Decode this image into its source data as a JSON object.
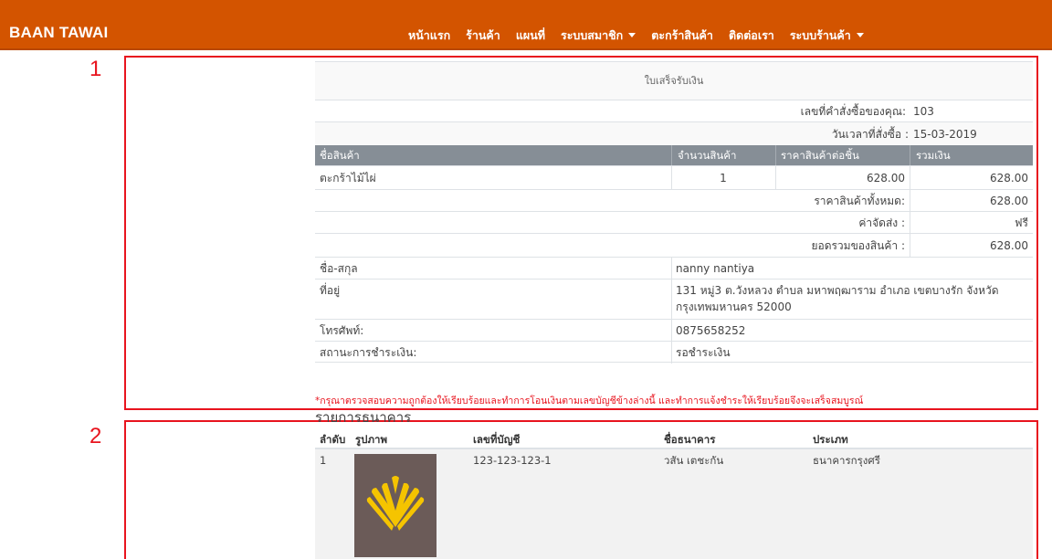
{
  "navbar": {
    "brand": "BAAN TAWAI",
    "items": [
      {
        "label": "หน้าแรก",
        "dropdown": false
      },
      {
        "label": "ร้านค้า",
        "dropdown": false
      },
      {
        "label": "แผนที่",
        "dropdown": false
      },
      {
        "label": "ระบบสมาชิก",
        "dropdown": true
      },
      {
        "label": "ตะกร้าสินค้า",
        "dropdown": false
      },
      {
        "label": "ติดต่อเรา",
        "dropdown": false
      },
      {
        "label": "ระบบร้านค้า",
        "dropdown": true
      }
    ],
    "color": "#d35400"
  },
  "annotations": {
    "box1_label": "1",
    "box2_label": "2",
    "color": "#e8141e"
  },
  "receipt": {
    "title": "ใบเสร็จรับเงิน",
    "order_no_label": "เลขที่คำสั่งซื้อของคุณ:",
    "order_no": "103",
    "order_date_label": "วันเวลาที่สั่งซื้อ :",
    "order_date": "15-03-2019",
    "headers": [
      "ชื่อสินค้า",
      "จำนวนสินค้า",
      "ราคาสินค้าต่อชิ้น",
      "รวมเงิน"
    ],
    "items": [
      {
        "name": "ตะกร้าไม้ไผ่",
        "qty": "1",
        "unit_price": "628.00",
        "total": "628.00"
      }
    ],
    "subtotal_label": "ราคาสินค้าทั้งหมด:",
    "subtotal": "628.00",
    "shipping_label": "ค่าจัดส่ง :",
    "shipping": "ฟรี",
    "grand_total_label": "ยอดรวมของสินค้า :",
    "grand_total": "628.00",
    "customer": {
      "name_label": "ชื่อ-สกุล",
      "name": "nanny nantiya",
      "address_label": "ที่อยู่",
      "address_line1": "131 หมู่3 ต.วังหลวง ตำบล มหาพฤฒาราม อำเภอ เขตบางรัก จังหวัด",
      "address_line2": "กรุงเทพมหานคร 52000",
      "phone_label": "โทรศัพท์:",
      "phone": "0875658252",
      "status_label": "สถานะการชำระเงิน:",
      "status": "รอชำระเงิน"
    },
    "note": "*กรุณาตรวจสอบความถูกต้องให้เรียบร้อยและทำการโอนเงินตามเลขบัญชีข้างล่างนี้ และทำการแจ้งชำระให้เรียบร้อยจึงจะเสร็จสมบูรณ์"
  },
  "bank": {
    "title": "รายการธนาคาร",
    "headers": [
      "ลำดับ",
      "รูปภาพ",
      "เลขที่บัญชี",
      "ชื่อธนาคาร",
      "ประเภท"
    ],
    "rows": [
      {
        "index": "1",
        "logo": "krungsri-logo",
        "account_no": "123-123-123-1",
        "account_name": "วสัน เตชะกัน",
        "bank_name": "ธนาคารกรุงศรี"
      }
    ],
    "logo_bg": "#6b5b58",
    "logo_fg": "#f5c400"
  }
}
